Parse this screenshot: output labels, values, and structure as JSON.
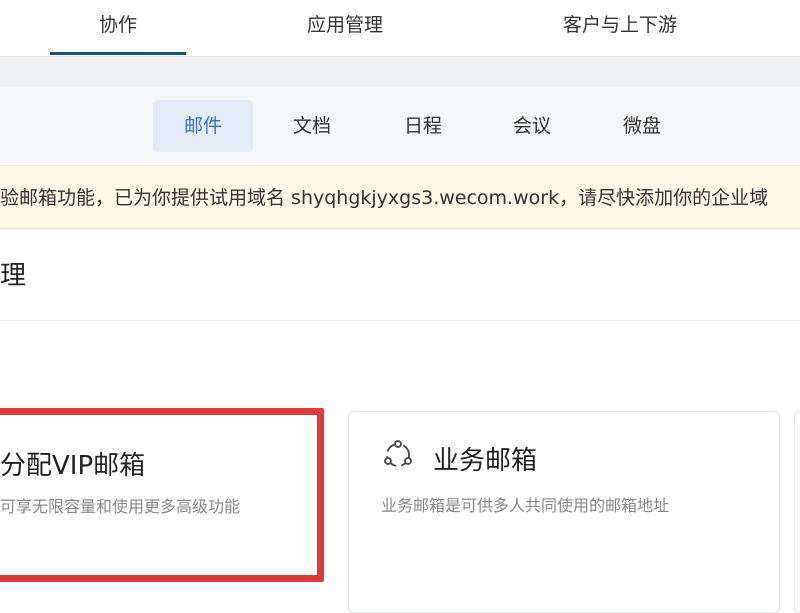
{
  "top_nav": {
    "tabs": [
      {
        "label": "协作",
        "active": true
      },
      {
        "label": "应用管理",
        "active": false
      },
      {
        "label": "客户与上下游",
        "active": false
      }
    ]
  },
  "sub_nav": {
    "tabs": [
      {
        "label": "邮件",
        "active": true
      },
      {
        "label": "文档",
        "active": false
      },
      {
        "label": "日程",
        "active": false
      },
      {
        "label": "会议",
        "active": false
      },
      {
        "label": "微盘",
        "active": false
      }
    ]
  },
  "notice": {
    "text": "验邮箱功能，已为你提供试用域名 shyqhgkjyxgs3.wecom.work，请尽快添加你的企业域"
  },
  "section": {
    "title": "理"
  },
  "cards": [
    {
      "title": "分配VIP邮箱",
      "description": "可享无限容量和使用更多高级功能",
      "highlighted": true
    },
    {
      "title": "业务邮箱",
      "description": "业务邮箱是可供多人共同使用的邮箱地址",
      "icon": "shared-mailbox-icon"
    }
  ],
  "colors": {
    "highlight_border": "#e03a3a",
    "active_subtab_bg": "#e3ebf7",
    "active_subtab_text": "#3b6fc9",
    "notice_bg": "#fdf7e3",
    "active_tab_underline": "#1f4e79"
  }
}
